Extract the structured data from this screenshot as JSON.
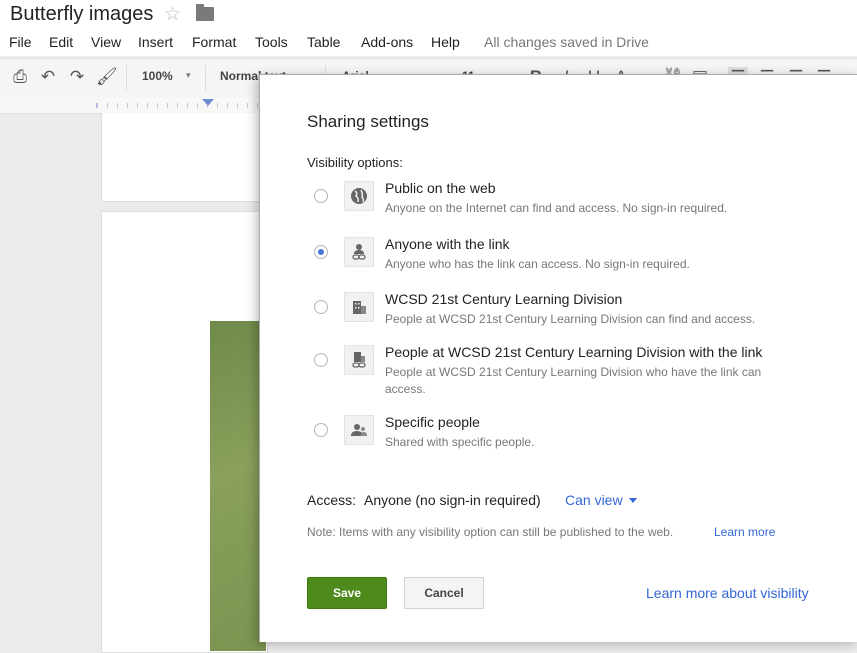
{
  "document": {
    "title": "Butterfly images",
    "star_icon": "star-icon",
    "folder_icon": "folder-icon"
  },
  "menu": {
    "items": [
      "File",
      "Edit",
      "View",
      "Insert",
      "Format",
      "Tools",
      "Table",
      "Add-ons",
      "Help"
    ],
    "status": "All changes saved in Drive"
  },
  "toolbar": {
    "icons": [
      "print-icon",
      "undo-icon",
      "redo-icon",
      "paint-format-icon",
      "bold-icon",
      "italic-icon",
      "underline-icon",
      "text-color-icon",
      "link-icon",
      "comment-icon",
      "align-left-icon",
      "align-center-icon",
      "align-right-icon",
      "justify-icon"
    ],
    "zoom": "100%",
    "style": "Normal text",
    "font": "Arial",
    "size": "11"
  },
  "dialog": {
    "title": "Sharing settings",
    "visibility_label": "Visibility options:",
    "options": [
      {
        "title": "Public on the web",
        "desc": "Anyone on the Internet can find and access. No sign-in required.",
        "icon": "globe-icon",
        "selected": false
      },
      {
        "title": "Anyone with the link",
        "desc": "Anyone who has the link can access. No sign-in required.",
        "icon": "person-link-icon",
        "selected": true
      },
      {
        "title": "WCSD 21st Century Learning Division",
        "desc": "People at WCSD 21st Century Learning Division can find and access.",
        "icon": "building-icon",
        "selected": false
      },
      {
        "title": "People at WCSD 21st Century Learning Division with the link",
        "desc": "People at WCSD 21st Century Learning Division who have the link can access.",
        "icon": "building-link-icon",
        "selected": false
      },
      {
        "title": "Specific people",
        "desc": "Shared with specific people.",
        "icon": "people-icon",
        "selected": false
      }
    ],
    "access_label": "Access:",
    "access_value": "Anyone (no sign-in required)",
    "access_level": "Can view",
    "note": "Note: Items with any visibility option can still be published to the web.",
    "note_link": "Learn more",
    "save_label": "Save",
    "cancel_label": "Cancel",
    "learn_more_label": "Learn more about visibility"
  },
  "colors": {
    "save_button": "#4e8b1c",
    "link": "#3367d6",
    "radio_selected": "#4a76d4"
  }
}
